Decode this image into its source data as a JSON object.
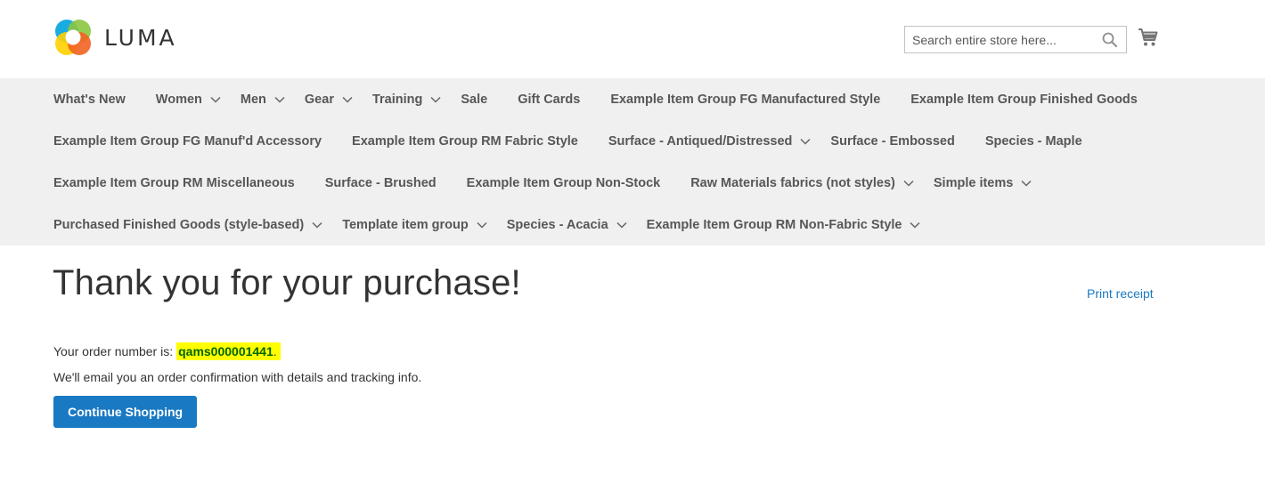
{
  "header": {
    "logo_text": "LUMA",
    "search": {
      "placeholder": "Search entire store here..."
    },
    "icons": {
      "search": "search-icon",
      "cart": "cart-icon",
      "logo": "luma-logo-icon"
    }
  },
  "nav": {
    "rows": [
      [
        {
          "label": "What's New",
          "dropdown": false
        },
        {
          "label": "Women",
          "dropdown": true
        },
        {
          "label": "Men",
          "dropdown": true
        },
        {
          "label": "Gear",
          "dropdown": true
        },
        {
          "label": "Training",
          "dropdown": true
        },
        {
          "label": "Sale",
          "dropdown": false
        },
        {
          "label": "Gift Cards",
          "dropdown": false
        },
        {
          "label": "Example Item Group FG Manufactured Style",
          "dropdown": false
        },
        {
          "label": "Example Item Group Finished Goods",
          "dropdown": false
        }
      ],
      [
        {
          "label": "Example Item Group FG Manuf'd Accessory",
          "dropdown": false
        },
        {
          "label": "Example Item Group RM Fabric Style",
          "dropdown": false
        },
        {
          "label": "Surface - Antiqued/Distressed",
          "dropdown": true
        },
        {
          "label": "Surface - Embossed",
          "dropdown": false
        },
        {
          "label": "Species - Maple",
          "dropdown": false
        }
      ],
      [
        {
          "label": "Example Item Group RM Miscellaneous",
          "dropdown": false
        },
        {
          "label": "Surface - Brushed",
          "dropdown": false
        },
        {
          "label": "Example Item Group Non-Stock",
          "dropdown": false
        },
        {
          "label": "Raw Materials fabrics (not styles)",
          "dropdown": true
        },
        {
          "label": "Simple items",
          "dropdown": true
        }
      ],
      [
        {
          "label": "Purchased Finished Goods (style-based)",
          "dropdown": true
        },
        {
          "label": "Template item group",
          "dropdown": true
        },
        {
          "label": "Species - Acacia",
          "dropdown": true
        },
        {
          "label": "Example Item Group RM Non-Fabric Style",
          "dropdown": true
        }
      ]
    ]
  },
  "main": {
    "title": "Thank you for your purchase!",
    "print_receipt": "Print receipt",
    "order_prefix": "Your order number is:",
    "order_number": "qams000001441",
    "order_suffix": ".",
    "confirmation": "We'll email you an order confirmation with details and tracking info.",
    "continue_button": "Continue Shopping"
  },
  "colors": {
    "accent": "#1979c3",
    "nav_bg": "#f0f0f0",
    "highlight": "#ffff00",
    "order_number": "#006400",
    "logo_orange": "#f26322",
    "logo_green": "#8cc63f",
    "logo_blue": "#00a3e0",
    "logo_yellow": "#ffd200"
  }
}
